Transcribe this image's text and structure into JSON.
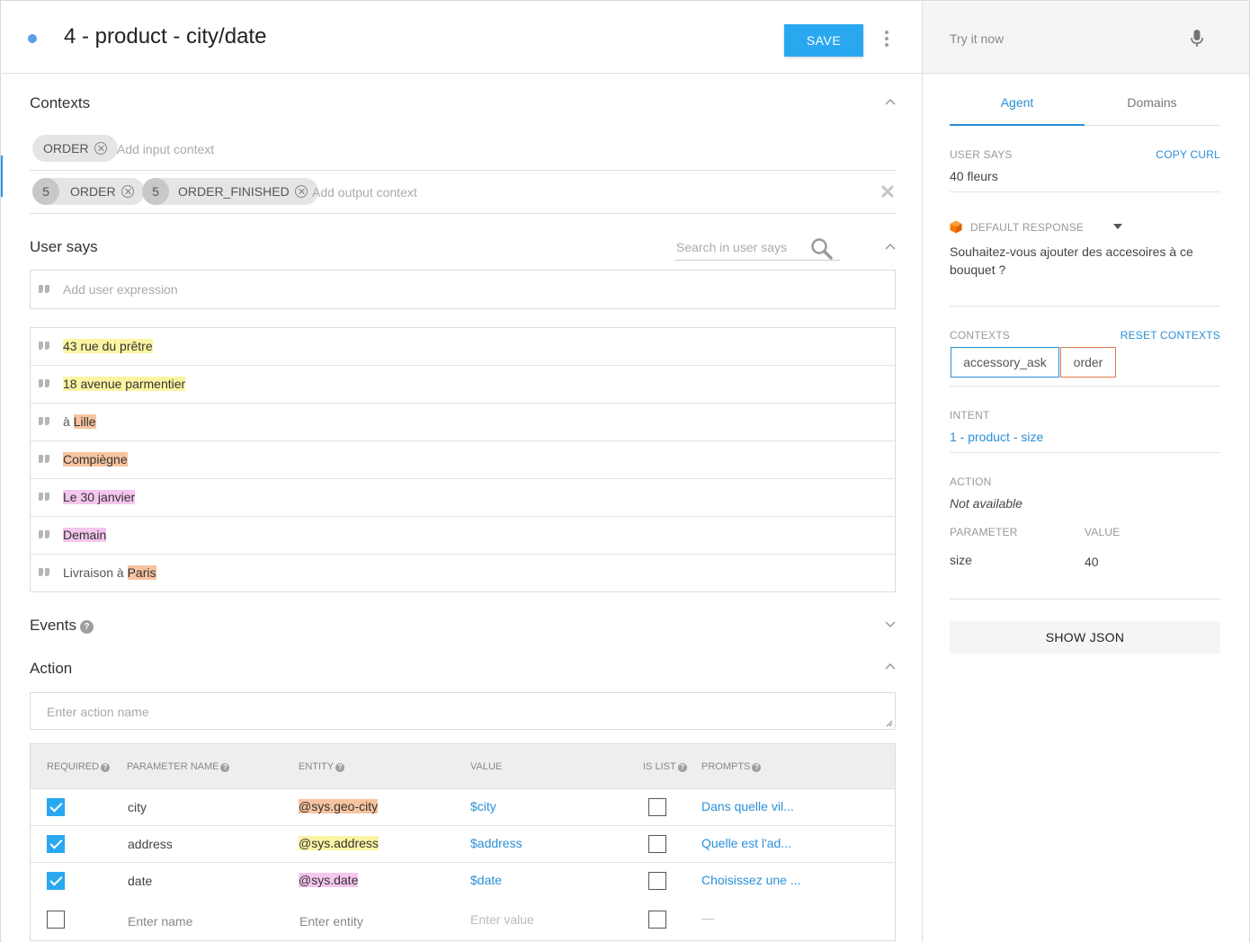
{
  "header": {
    "title": "4 - product - city/date",
    "save_label": "SAVE"
  },
  "contexts": {
    "title": "Contexts",
    "input_chips": [
      {
        "label": "ORDER"
      }
    ],
    "input_placeholder": "Add input context",
    "output_chips": [
      {
        "lifespan": "5",
        "label": "ORDER"
      },
      {
        "lifespan": "5",
        "label": "ORDER_FINISHED"
      }
    ],
    "output_placeholder": "Add output context"
  },
  "user_says": {
    "title": "User says",
    "search_placeholder": "Search in user says",
    "add_placeholder": "Add user expression",
    "items": [
      {
        "parts": [
          {
            "t": "43 rue du prêtre",
            "hl": "y"
          }
        ]
      },
      {
        "parts": [
          {
            "t": "18 avenue parmentier",
            "hl": "y"
          }
        ]
      },
      {
        "parts": [
          {
            "t": "à ",
            "hl": ""
          },
          {
            "t": "Lille",
            "hl": "o"
          }
        ]
      },
      {
        "parts": [
          {
            "t": "Compiègne",
            "hl": "o"
          }
        ]
      },
      {
        "parts": [
          {
            "t": "Le 30 janvier",
            "hl": "p"
          }
        ]
      },
      {
        "parts": [
          {
            "t": "Demain",
            "hl": "p"
          }
        ]
      },
      {
        "parts": [
          {
            "t": "Livraison à ",
            "hl": ""
          },
          {
            "t": "Paris",
            "hl": "o"
          }
        ]
      }
    ]
  },
  "events": {
    "title": "Events"
  },
  "action": {
    "title": "Action",
    "placeholder": "Enter action name",
    "columns": {
      "required": "REQUIRED",
      "name": "PARAMETER NAME",
      "entity": "ENTITY",
      "value": "VALUE",
      "is_list": "IS LIST",
      "prompts": "PROMPTS"
    },
    "rows": [
      {
        "required": true,
        "name": "city",
        "entity": "@sys.geo-city",
        "entity_hl": "o",
        "value": "$city",
        "is_list": false,
        "prompt": "Dans quelle vil..."
      },
      {
        "required": true,
        "name": "address",
        "entity": "@sys.address",
        "entity_hl": "y",
        "value": "$address",
        "is_list": false,
        "prompt": "Quelle est l'ad..."
      },
      {
        "required": true,
        "name": "date",
        "entity": "@sys.date",
        "entity_hl": "p",
        "value": "$date",
        "is_list": false,
        "prompt": "Choisissez une ..."
      }
    ],
    "new_row": {
      "name_placeholder": "Enter name",
      "entity_placeholder": "Enter entity",
      "value_placeholder": "Enter value",
      "prompt_placeholder": "—"
    }
  },
  "right": {
    "try_placeholder": "Try it now",
    "tabs": [
      {
        "label": "Agent"
      },
      {
        "label": "Domains"
      }
    ],
    "user_says_label": "USER SAYS",
    "copy_curl": "COPY CURL",
    "user_says_value": "40 fleurs",
    "default_response_label": "DEFAULT RESPONSE",
    "default_response_text": "Souhaitez-vous ajouter des accesoires à ce bouquet ?",
    "contexts_label": "CONTEXTS",
    "reset_contexts": "RESET CONTEXTS",
    "context_chips": [
      {
        "label": "accessory_ask"
      },
      {
        "label": "order"
      }
    ],
    "intent_label": "INTENT",
    "intent_value": "1 - product - size",
    "action_label": "ACTION",
    "action_value": "Not available",
    "param_label": "PARAMETER",
    "value_label": "VALUE",
    "param_name": "size",
    "param_value": "40",
    "show_json": "SHOW JSON"
  },
  "colors": {
    "accent": "#29a8f0",
    "link": "#2b8fd6",
    "hl_yellow": "#fbf5a3",
    "hl_orange": "#f7c4a0",
    "hl_pink": "#f5c6ee",
    "ctx_blue": "#2b8fd6",
    "ctx_orange": "#e07a4a"
  }
}
